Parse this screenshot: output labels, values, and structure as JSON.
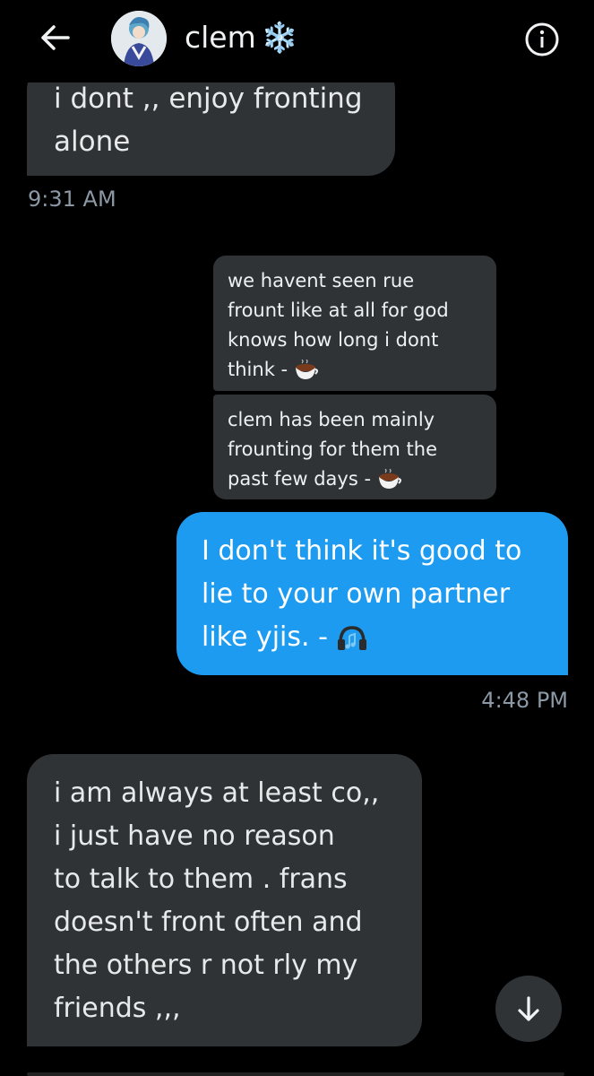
{
  "header": {
    "title": "clem",
    "title_emoji": "❄️",
    "back_icon": "arrow-left-icon",
    "info_icon": "info-circle-icon"
  },
  "messages": [
    {
      "id": "m1",
      "side": "left",
      "text_lines": [
        "i dont ,, enjoy fronting",
        "alone"
      ]
    },
    {
      "id": "t1",
      "timestamp": "9:31 AM"
    },
    {
      "id": "q1",
      "kind": "quoted",
      "text_lines": [
        "we havent seen rue",
        "frount like at all for god",
        "knows how long i dont",
        "think -"
      ],
      "emoji": "coffee-cup"
    },
    {
      "id": "q2",
      "kind": "quoted",
      "text_lines": [
        "clem has been mainly",
        "frounting for them the",
        "past few days -"
      ],
      "emoji": "coffee-cup"
    },
    {
      "id": "m2",
      "side": "right",
      "text_lines": [
        "I don't think it's good to",
        "lie to your own partner",
        "like yjis. -"
      ],
      "emoji": "headphones"
    },
    {
      "id": "t2",
      "timestamp": "4:48 PM"
    },
    {
      "id": "m3",
      "side": "left",
      "text_lines": [
        "i am always at least co,,",
        "i just have no reason",
        "to talk to them . frans",
        "doesn't front often and",
        "the others r not rly my",
        "friends ,,,"
      ]
    }
  ],
  "scroll_button_icon": "arrow-down-icon",
  "colors": {
    "background": "#000000",
    "received_bubble": "#2f3336",
    "sent_bubble": "#1d9bf0",
    "timestamp": "#8b98a5"
  }
}
